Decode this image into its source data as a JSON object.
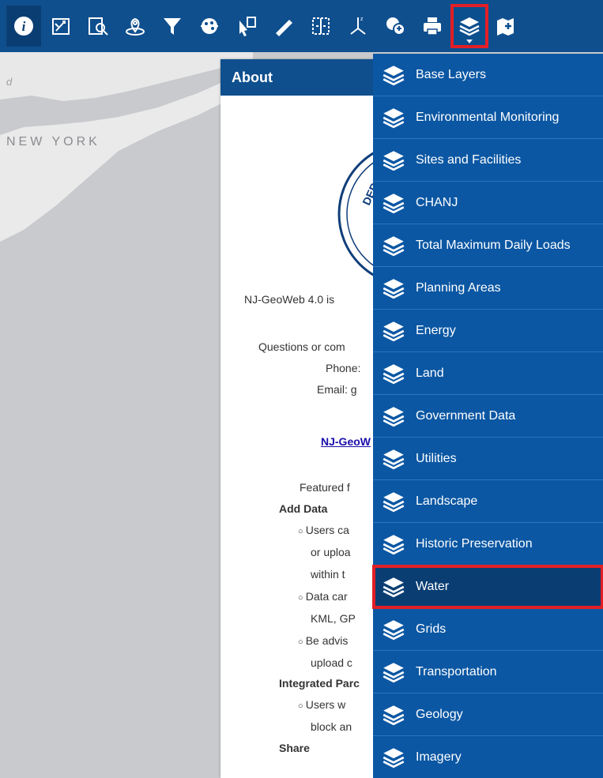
{
  "toolbar": {
    "buttons": [
      {
        "name": "info",
        "icon": "info-icon"
      },
      {
        "name": "draw",
        "icon": "draw-map-icon"
      },
      {
        "name": "search",
        "icon": "search-icon"
      },
      {
        "name": "locate",
        "icon": "location-icon"
      },
      {
        "name": "filter",
        "icon": "filter-icon"
      },
      {
        "name": "bookmark",
        "icon": "bookmark-icon"
      },
      {
        "name": "select",
        "icon": "select-icon"
      },
      {
        "name": "measure",
        "icon": "measure-icon"
      },
      {
        "name": "swipe",
        "icon": "swipe-icon"
      },
      {
        "name": "coordinates",
        "icon": "coordinates-icon"
      },
      {
        "name": "identify",
        "icon": "identify-icon"
      },
      {
        "name": "print",
        "icon": "print-icon"
      },
      {
        "name": "layers",
        "icon": "layers-icon"
      },
      {
        "name": "add-data",
        "icon": "add-data-icon"
      }
    ],
    "colors": {
      "bar": "#0f4f8e",
      "highlight": "#e21f26"
    }
  },
  "map": {
    "corner_label": "d",
    "place_label": "NEW YORK"
  },
  "about": {
    "title": "About",
    "lines": {
      "intro": "NJ-GeoWeb 4.0 is",
      "questions": "Questions or com",
      "phone": "Phone:",
      "email": "Email: g",
      "link": "NJ-GeoW",
      "featured": "Featured f",
      "add_data": "Add Data",
      "b1a": "Users ca",
      "b1b": "or uploa",
      "b1c": "within t",
      "b2a": "Data car",
      "b2b": "KML, GP",
      "b3a": "Be advis",
      "b3b": "upload c",
      "integrated": "Integrated Parc",
      "b4a": "Users w",
      "b4b": "block an",
      "share": "Share"
    }
  },
  "layer_menu": {
    "items": [
      "Base Layers",
      "Environmental Monitoring",
      "Sites and Facilities",
      "CHANJ",
      "Total Maximum Daily Loads",
      "Planning Areas",
      "Energy",
      "Land",
      "Government Data",
      "Utilities",
      "Landscape",
      "Historic Preservation",
      "Water",
      "Grids",
      "Transportation",
      "Geology",
      "Imagery"
    ],
    "selected": "Water",
    "icon": "layers-icon",
    "colors": {
      "background": "#0b57a3",
      "selected": "#0a3e73",
      "highlight": "#e21f26"
    }
  }
}
